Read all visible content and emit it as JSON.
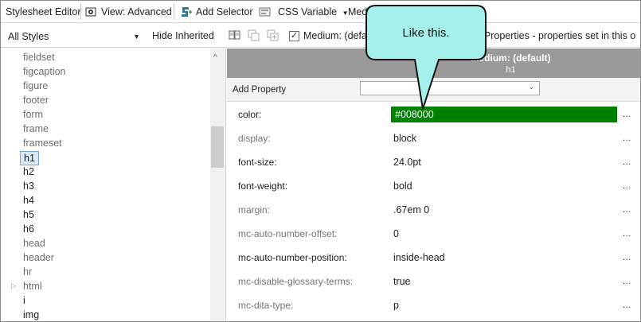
{
  "toolbar": {
    "title": "Stylesheet Editor",
    "view_label": "View: Advanced",
    "add_selector_label": "Add Selector",
    "css_variable_label": "CSS Variable",
    "medium_label_partial": "Medi"
  },
  "filterbar": {
    "style_filter": "All Styles",
    "hide_inherited_label": "Hide Inherited",
    "medium_checkbox_label": "Medium: (defau",
    "medium_checked": true,
    "properties_hint": "et Properties - properties set in this o"
  },
  "tree": {
    "items": [
      {
        "label": "fieldset",
        "muted": true
      },
      {
        "label": "figcaption",
        "muted": true
      },
      {
        "label": "figure",
        "muted": true
      },
      {
        "label": "footer",
        "muted": true
      },
      {
        "label": "form",
        "muted": true
      },
      {
        "label": "frame",
        "muted": true
      },
      {
        "label": "frameset",
        "muted": true
      },
      {
        "label": "h1",
        "muted": false,
        "selected": true
      },
      {
        "label": "h2",
        "muted": false
      },
      {
        "label": "h3",
        "muted": false
      },
      {
        "label": "h4",
        "muted": false
      },
      {
        "label": "h5",
        "muted": false
      },
      {
        "label": "h6",
        "muted": false
      },
      {
        "label": "head",
        "muted": true
      },
      {
        "label": "header",
        "muted": true
      },
      {
        "label": "hr",
        "muted": true
      },
      {
        "label": "html",
        "muted": true,
        "expandable": true
      },
      {
        "label": "i",
        "muted": false
      },
      {
        "label": "img",
        "muted": false
      }
    ]
  },
  "properties": {
    "medium_header": "Medium: (default)",
    "selector_header": "h1",
    "add_property_label": "Add Property",
    "more_label": "...",
    "rows": [
      {
        "name": "color:",
        "value": "#008000",
        "muted": false,
        "highlight": "#008000"
      },
      {
        "name": "display:",
        "value": "block",
        "muted": true
      },
      {
        "name": "font-size:",
        "value": "24.0pt",
        "muted": false
      },
      {
        "name": "font-weight:",
        "value": "bold",
        "muted": false
      },
      {
        "name": "margin:",
        "value": ".67em 0",
        "muted": true
      },
      {
        "name": "mc-auto-number-offset:",
        "value": "0",
        "muted": true
      },
      {
        "name": "mc-auto-number-position:",
        "value": "inside-head",
        "muted": false
      },
      {
        "name": "mc-disable-glossary-terms:",
        "value": "true",
        "muted": true
      },
      {
        "name": "mc-dita-type:",
        "value": "p",
        "muted": true
      }
    ]
  },
  "callout": {
    "text": "Like this.",
    "fill": "#a5f0ea"
  }
}
